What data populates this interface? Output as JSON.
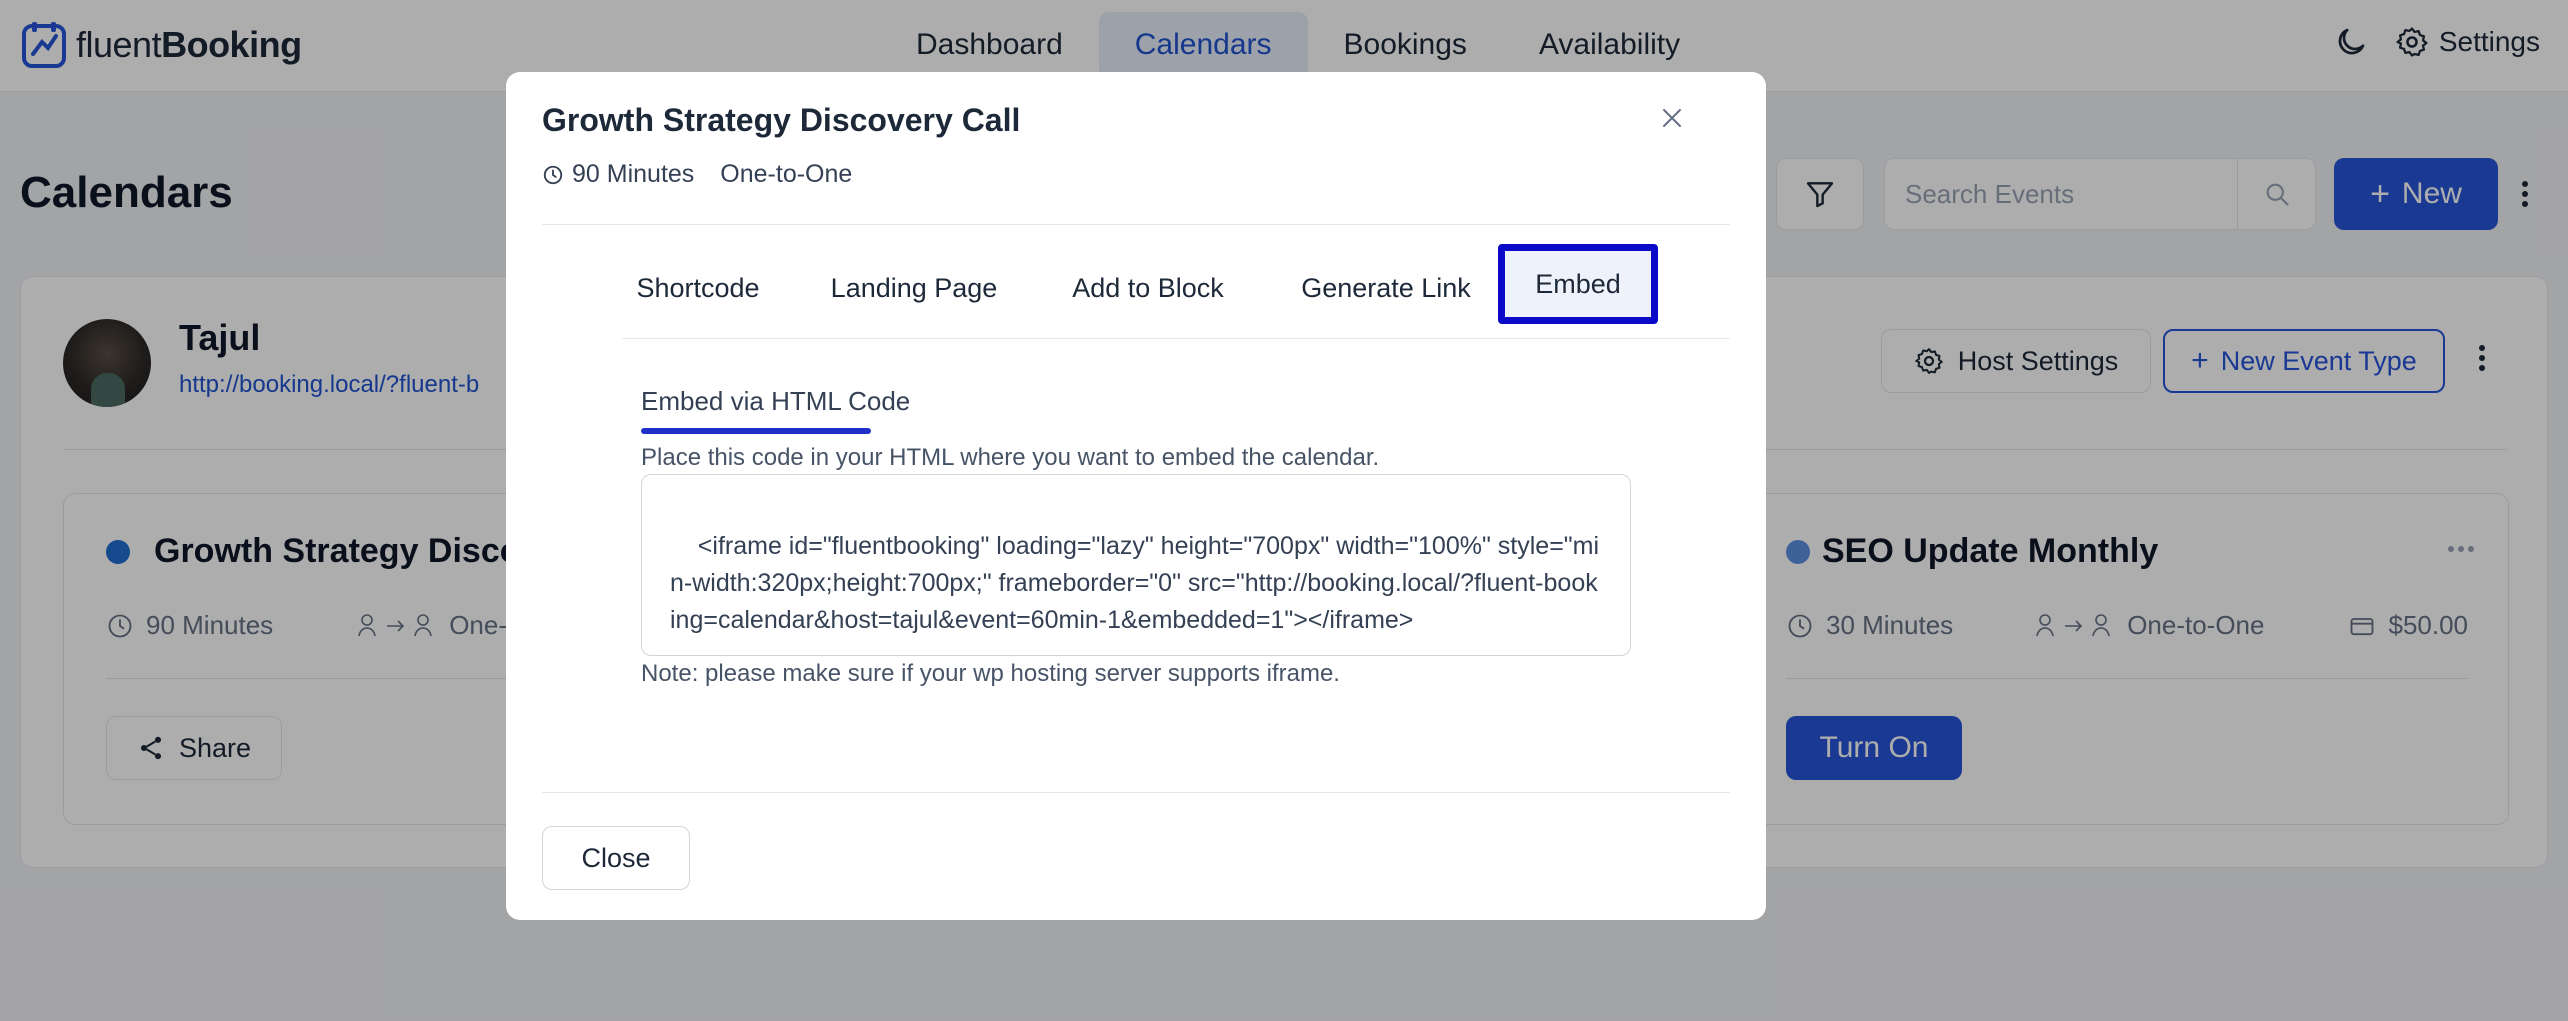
{
  "app": {
    "logo_text_light": "fluent",
    "logo_text_bold": "Booking",
    "nav": [
      {
        "label": "Dashboard"
      },
      {
        "label": "Calendars"
      },
      {
        "label": "Bookings"
      },
      {
        "label": "Availability"
      }
    ],
    "active_nav": "Calendars",
    "settings_label": "Settings",
    "accent": "#2655d9"
  },
  "page": {
    "title": "Calendars",
    "search_placeholder": "Search Events",
    "new_label": "New"
  },
  "host": {
    "name": "Tajul",
    "link": "http://booking.local/?fluent-b",
    "host_settings_label": "Host Settings",
    "new_event_type_label": "New Event Type"
  },
  "event_left": {
    "title": "Growth Strategy Discov",
    "duration": "90 Minutes",
    "type": "One-",
    "share_label": "Share",
    "dot_color": "#1f6fd1"
  },
  "event_right": {
    "title": "SEO Update Monthly",
    "duration": "30 Minutes",
    "type": "One-to-One",
    "price": "$50.00",
    "turn_on_label": "Turn On",
    "dot_color": "#5b8fe0"
  },
  "modal": {
    "title": "Growth Strategy Discovery Call",
    "duration": "90 Minutes",
    "type": "One-to-One",
    "tabs": [
      {
        "label": "Shortcode"
      },
      {
        "label": "Landing Page"
      },
      {
        "label": "Add to Block"
      },
      {
        "label": "Generate Link"
      },
      {
        "label": "Embed"
      }
    ],
    "active_tab": "Embed",
    "embed": {
      "heading": "Embed via HTML Code",
      "description": "Place this code in your HTML where you want to embed the calendar.",
      "code": "<iframe id=\"fluentbooking\" loading=\"lazy\" height=\"700px\" width=\"100%\" style=\"min-width:320px;height:700px;\" frameborder=\"0\" src=\"http://booking.local/?fluent-booking=calendar&host=tajul&event=60min-1&embedded=1\"></iframe>",
      "note": "Note: please make sure if your wp hosting server supports iframe."
    },
    "close_label": "Close"
  }
}
